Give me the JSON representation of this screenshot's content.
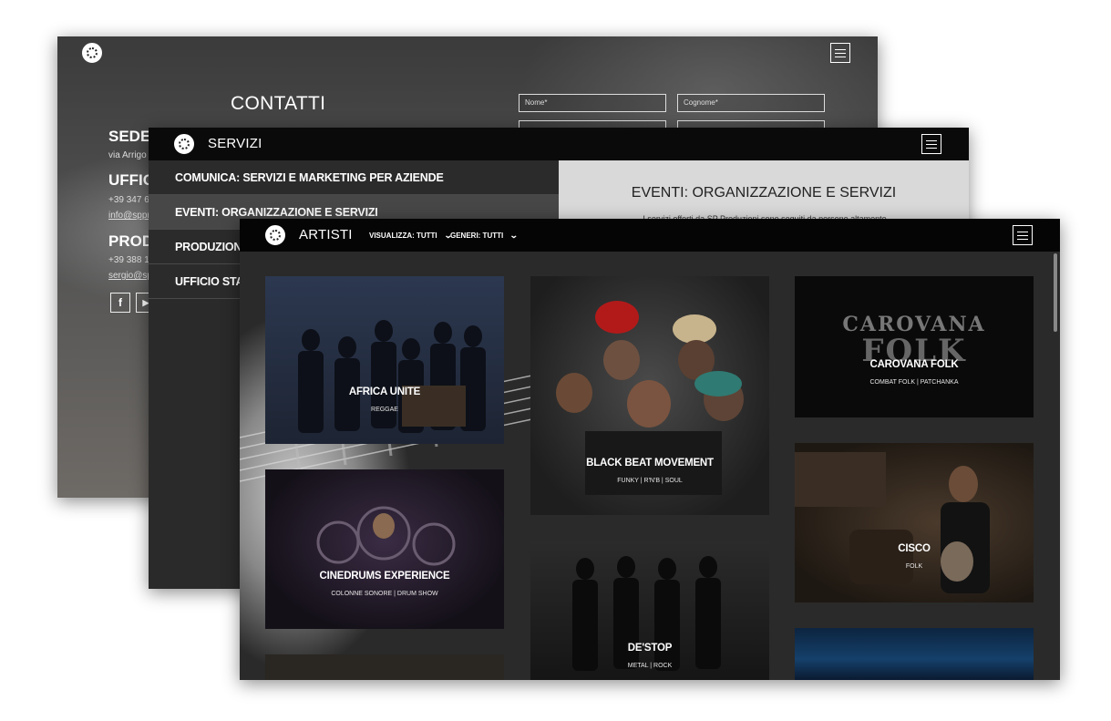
{
  "contatti": {
    "title": "CONTATTI",
    "fields": {
      "nome": "Nome*",
      "cognome": "Cognome*"
    },
    "sede_heading": "SEDE L",
    "sede_address": "via Arrigo",
    "ufficio_heading": "UFFICI",
    "ufficio_phone": "+39 347 6",
    "ufficio_email": "info@sppr",
    "produzioni_heading": "PRODU",
    "produzioni_phone": "+39 388 1",
    "produzioni_email": "sergio@sp",
    "social": {
      "facebook": "f",
      "youtube": "▶"
    }
  },
  "servizi": {
    "title": "SERVIZI",
    "menu": [
      "COMUNICA: SERVIZI E MARKETING PER AZIENDE",
      "EVENTI: ORGANIZZAZIONE E SERVIZI",
      "PRODUZIONI |",
      "UFFICIO STAMI"
    ],
    "detail_title": "EVENTI: ORGANIZZAZIONE E SERVIZI",
    "detail_text": "I servizi offerti da SP Produzioni sono seguiti da persone altamente"
  },
  "artisti": {
    "title": "ARTISTI",
    "filter_visualizza": "VISUALIZZA: TUTTI",
    "filter_generi": "GENERI: TUTTI",
    "cards": [
      {
        "name": "AFRICA UNITE",
        "genre": "REGGAE"
      },
      {
        "name": "BLACK BEAT MOVEMENT",
        "genre": "FUNKY | R'N'B | SOUL"
      },
      {
        "name": "CAROVANA FOLK",
        "genre": "COMBAT FOLK | PATCHANKA"
      },
      {
        "name": "CINEDRUMS EXPERIENCE",
        "genre": "COLONNE SONORE | DRUM SHOW"
      },
      {
        "name": "DE'STOP",
        "genre": "METAL | ROCK"
      },
      {
        "name": "CISCO",
        "genre": "FOLK"
      }
    ],
    "carovana_logo": {
      "line1": "CAROVANA",
      "line2": "FOLK"
    }
  }
}
